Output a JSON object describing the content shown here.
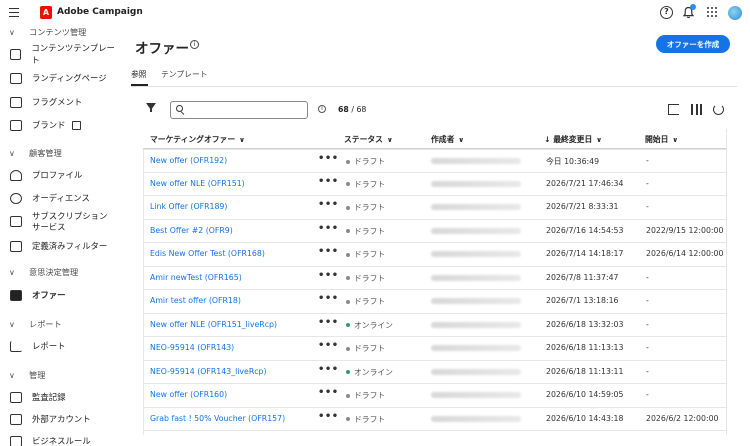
{
  "app": {
    "title": "Adobe Campaign",
    "logo_letter": "A"
  },
  "header": {
    "help_symbol": "?"
  },
  "sidebar": {
    "sections": [
      {
        "label": "コンテンツ管理"
      },
      {
        "label": "顧客管理"
      },
      {
        "label": "意思決定管理"
      },
      {
        "label": "レポート"
      },
      {
        "label": "管理"
      }
    ],
    "items": [
      {
        "label": "コンテンツテンプレート",
        "icon": "template-icon"
      },
      {
        "label": "ランディングページ",
        "icon": "landing-page-icon"
      },
      {
        "label": "フラグメント",
        "icon": "fragment-icon"
      },
      {
        "label": "ブランド",
        "icon": "brand-icon"
      },
      {
        "label": "プロファイル",
        "icon": "profile-icon"
      },
      {
        "label": "オーディエンス",
        "icon": "audience-icon"
      },
      {
        "label": "サブスクリプションサービス",
        "icon": "subscription-icon"
      },
      {
        "label": "定義済みフィルター",
        "icon": "filter-icon"
      },
      {
        "label": "オファー",
        "icon": "offer-icon"
      },
      {
        "label": "レポート",
        "icon": "report-icon"
      },
      {
        "label": "監査記録",
        "icon": "audit-icon"
      },
      {
        "label": "外部アカウント",
        "icon": "external-account-icon"
      },
      {
        "label": "ビジネスルール",
        "icon": "business-rule-icon"
      }
    ]
  },
  "main": {
    "title": "オファー",
    "create_button": "オファーを作成",
    "tabs": [
      {
        "label": "参照"
      },
      {
        "label": "テンプレート"
      }
    ],
    "search": {
      "value": "",
      "placeholder": ""
    },
    "count": {
      "shown": "68",
      "separator": " / ",
      "total": "68"
    },
    "info_symbol": "i"
  },
  "table": {
    "columns": [
      {
        "label": "マーケティングオファー"
      },
      {
        "label": "ステータス"
      },
      {
        "label": "作成者"
      },
      {
        "label": "最終変更日"
      },
      {
        "label": "開始日"
      }
    ],
    "sort_arrow": "↓",
    "more_symbol": "•••",
    "rows": [
      {
        "name": "New offer (OFR192)",
        "status": "ドラフト",
        "status_color": "#8a8a8a",
        "modified": "今日 10:36:49",
        "start": "-"
      },
      {
        "name": "New offer NLE (OFR151)",
        "status": "ドラフト",
        "status_color": "#8a8a8a",
        "modified": "2026/7/21 17:46:34",
        "start": "-"
      },
      {
        "name": "Link Offer (OFR189)",
        "status": "ドラフト",
        "status_color": "#8a8a8a",
        "modified": "2026/7/21 8:33:31",
        "start": "-"
      },
      {
        "name": "Best Offer #2 (OFR9)",
        "status": "ドラフト",
        "status_color": "#8a8a8a",
        "modified": "2026/7/16 14:54:53",
        "start": "2022/9/15 12:00:00"
      },
      {
        "name": "Edis New Offer Test (OFR168)",
        "status": "ドラフト",
        "status_color": "#8a8a8a",
        "modified": "2026/7/14 14:18:17",
        "start": "2026/6/14 12:00:00"
      },
      {
        "name": "Amir newTest (OFR165)",
        "status": "ドラフト",
        "status_color": "#8a8a8a",
        "modified": "2026/7/8 11:37:47",
        "start": "-"
      },
      {
        "name": "Amir test offer (OFR18)",
        "status": "ドラフト",
        "status_color": "#8a8a8a",
        "modified": "2026/7/1 13:18:16",
        "start": "-"
      },
      {
        "name": "New offer NLE (OFR151_liveRcp)",
        "status": "オンライン",
        "status_color": "#2d9d78",
        "modified": "2026/6/18 13:32:03",
        "start": "-"
      },
      {
        "name": "NEO-95914 (OFR143)",
        "status": "ドラフト",
        "status_color": "#8a8a8a",
        "modified": "2026/6/18 11:13:13",
        "start": "-"
      },
      {
        "name": "NEO-95914 (OFR143_liveRcp)",
        "status": "オンライン",
        "status_color": "#2d9d78",
        "modified": "2026/6/18 11:13:11",
        "start": "-"
      },
      {
        "name": "New offer (OFR160)",
        "status": "ドラフト",
        "status_color": "#8a8a8a",
        "modified": "2026/6/10 14:59:05",
        "start": "-"
      },
      {
        "name": "Grab fast ! 50% Voucher (OFR157)",
        "status": "ドラフト",
        "status_color": "#8a8a8a",
        "modified": "2026/6/10 14:43:18",
        "start": "2026/6/2 12:00:00"
      }
    ]
  },
  "colors": {
    "accent": "#1473e6",
    "online": "#2d9d78",
    "draft": "#8a8a8a",
    "brand": "#eb1000"
  }
}
